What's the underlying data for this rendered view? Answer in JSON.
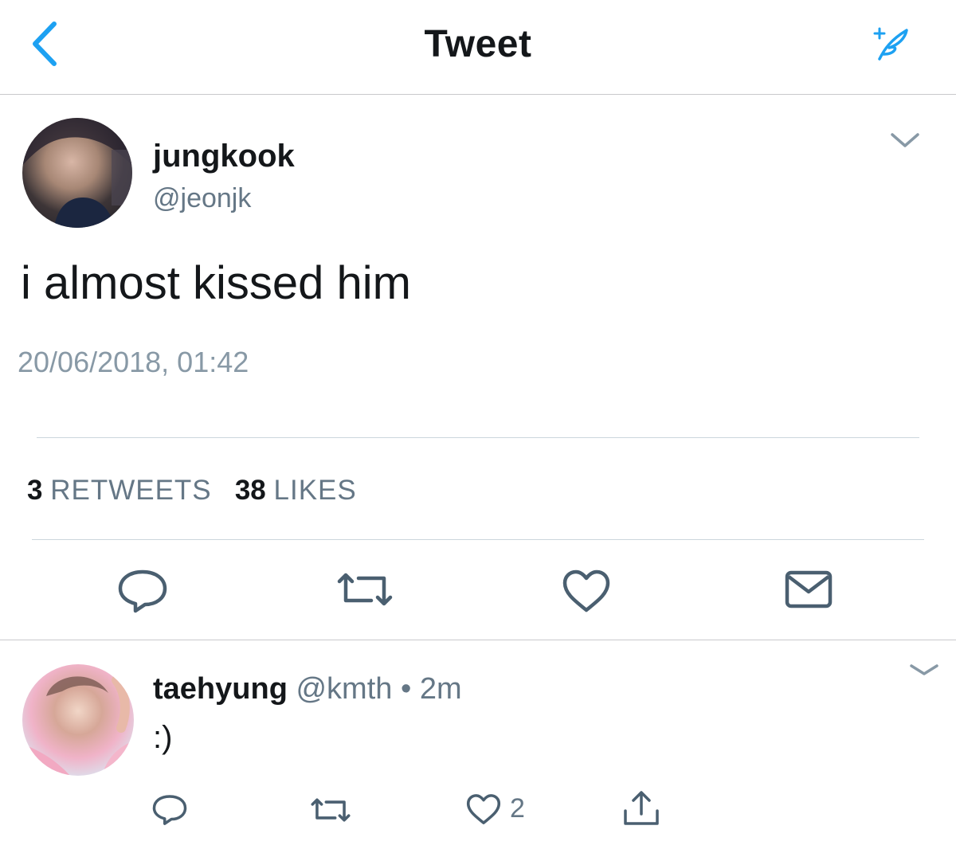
{
  "header": {
    "title": "Tweet",
    "back_icon": "chevron-left-icon",
    "compose_icon": "sparkle-feather-icon"
  },
  "tweet": {
    "author_name": "jungkook",
    "author_handle": "@jeonjk",
    "text": "i almost kissed him",
    "timestamp": "20/06/2018, 01:42",
    "retweet_count": "3",
    "retweet_label": "RETWEETS",
    "like_count": "38",
    "like_label": "LIKES",
    "actions": [
      "reply-icon",
      "retweet-icon",
      "like-icon",
      "message-icon"
    ]
  },
  "reply": {
    "author_name": "taehyung",
    "author_handle": "@kmth",
    "separator": "•",
    "time": "2m",
    "text": ":)",
    "like_count": "2",
    "actions": [
      "reply-icon",
      "retweet-icon",
      "like-icon",
      "share-icon"
    ]
  },
  "colors": {
    "accent": "#1da1f2",
    "icon": "#4a5f70",
    "secondary_text": "#657786"
  }
}
